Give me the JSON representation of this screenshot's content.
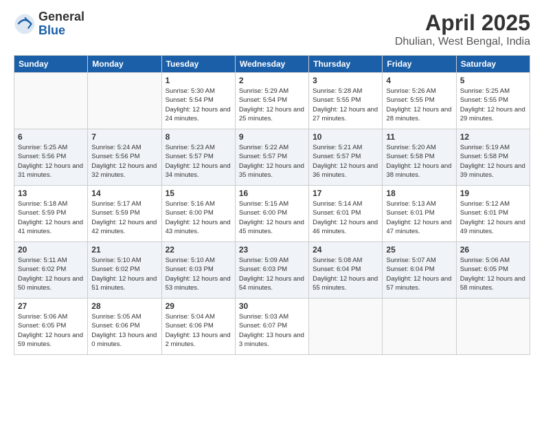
{
  "logo": {
    "general": "General",
    "blue": "Blue"
  },
  "title": "April 2025",
  "location": "Dhulian, West Bengal, India",
  "weekdays": [
    "Sunday",
    "Monday",
    "Tuesday",
    "Wednesday",
    "Thursday",
    "Friday",
    "Saturday"
  ],
  "weeks": [
    [
      {
        "day": "",
        "info": ""
      },
      {
        "day": "",
        "info": ""
      },
      {
        "day": "1",
        "info": "Sunrise: 5:30 AM\nSunset: 5:54 PM\nDaylight: 12 hours and 24 minutes."
      },
      {
        "day": "2",
        "info": "Sunrise: 5:29 AM\nSunset: 5:54 PM\nDaylight: 12 hours and 25 minutes."
      },
      {
        "day": "3",
        "info": "Sunrise: 5:28 AM\nSunset: 5:55 PM\nDaylight: 12 hours and 27 minutes."
      },
      {
        "day": "4",
        "info": "Sunrise: 5:26 AM\nSunset: 5:55 PM\nDaylight: 12 hours and 28 minutes."
      },
      {
        "day": "5",
        "info": "Sunrise: 5:25 AM\nSunset: 5:55 PM\nDaylight: 12 hours and 29 minutes."
      }
    ],
    [
      {
        "day": "6",
        "info": "Sunrise: 5:25 AM\nSunset: 5:56 PM\nDaylight: 12 hours and 31 minutes."
      },
      {
        "day": "7",
        "info": "Sunrise: 5:24 AM\nSunset: 5:56 PM\nDaylight: 12 hours and 32 minutes."
      },
      {
        "day": "8",
        "info": "Sunrise: 5:23 AM\nSunset: 5:57 PM\nDaylight: 12 hours and 34 minutes."
      },
      {
        "day": "9",
        "info": "Sunrise: 5:22 AM\nSunset: 5:57 PM\nDaylight: 12 hours and 35 minutes."
      },
      {
        "day": "10",
        "info": "Sunrise: 5:21 AM\nSunset: 5:57 PM\nDaylight: 12 hours and 36 minutes."
      },
      {
        "day": "11",
        "info": "Sunrise: 5:20 AM\nSunset: 5:58 PM\nDaylight: 12 hours and 38 minutes."
      },
      {
        "day": "12",
        "info": "Sunrise: 5:19 AM\nSunset: 5:58 PM\nDaylight: 12 hours and 39 minutes."
      }
    ],
    [
      {
        "day": "13",
        "info": "Sunrise: 5:18 AM\nSunset: 5:59 PM\nDaylight: 12 hours and 41 minutes."
      },
      {
        "day": "14",
        "info": "Sunrise: 5:17 AM\nSunset: 5:59 PM\nDaylight: 12 hours and 42 minutes."
      },
      {
        "day": "15",
        "info": "Sunrise: 5:16 AM\nSunset: 6:00 PM\nDaylight: 12 hours and 43 minutes."
      },
      {
        "day": "16",
        "info": "Sunrise: 5:15 AM\nSunset: 6:00 PM\nDaylight: 12 hours and 45 minutes."
      },
      {
        "day": "17",
        "info": "Sunrise: 5:14 AM\nSunset: 6:01 PM\nDaylight: 12 hours and 46 minutes."
      },
      {
        "day": "18",
        "info": "Sunrise: 5:13 AM\nSunset: 6:01 PM\nDaylight: 12 hours and 47 minutes."
      },
      {
        "day": "19",
        "info": "Sunrise: 5:12 AM\nSunset: 6:01 PM\nDaylight: 12 hours and 49 minutes."
      }
    ],
    [
      {
        "day": "20",
        "info": "Sunrise: 5:11 AM\nSunset: 6:02 PM\nDaylight: 12 hours and 50 minutes."
      },
      {
        "day": "21",
        "info": "Sunrise: 5:10 AM\nSunset: 6:02 PM\nDaylight: 12 hours and 51 minutes."
      },
      {
        "day": "22",
        "info": "Sunrise: 5:10 AM\nSunset: 6:03 PM\nDaylight: 12 hours and 53 minutes."
      },
      {
        "day": "23",
        "info": "Sunrise: 5:09 AM\nSunset: 6:03 PM\nDaylight: 12 hours and 54 minutes."
      },
      {
        "day": "24",
        "info": "Sunrise: 5:08 AM\nSunset: 6:04 PM\nDaylight: 12 hours and 55 minutes."
      },
      {
        "day": "25",
        "info": "Sunrise: 5:07 AM\nSunset: 6:04 PM\nDaylight: 12 hours and 57 minutes."
      },
      {
        "day": "26",
        "info": "Sunrise: 5:06 AM\nSunset: 6:05 PM\nDaylight: 12 hours and 58 minutes."
      }
    ],
    [
      {
        "day": "27",
        "info": "Sunrise: 5:06 AM\nSunset: 6:05 PM\nDaylight: 12 hours and 59 minutes."
      },
      {
        "day": "28",
        "info": "Sunrise: 5:05 AM\nSunset: 6:06 PM\nDaylight: 13 hours and 0 minutes."
      },
      {
        "day": "29",
        "info": "Sunrise: 5:04 AM\nSunset: 6:06 PM\nDaylight: 13 hours and 2 minutes."
      },
      {
        "day": "30",
        "info": "Sunrise: 5:03 AM\nSunset: 6:07 PM\nDaylight: 13 hours and 3 minutes."
      },
      {
        "day": "",
        "info": ""
      },
      {
        "day": "",
        "info": ""
      },
      {
        "day": "",
        "info": ""
      }
    ]
  ]
}
